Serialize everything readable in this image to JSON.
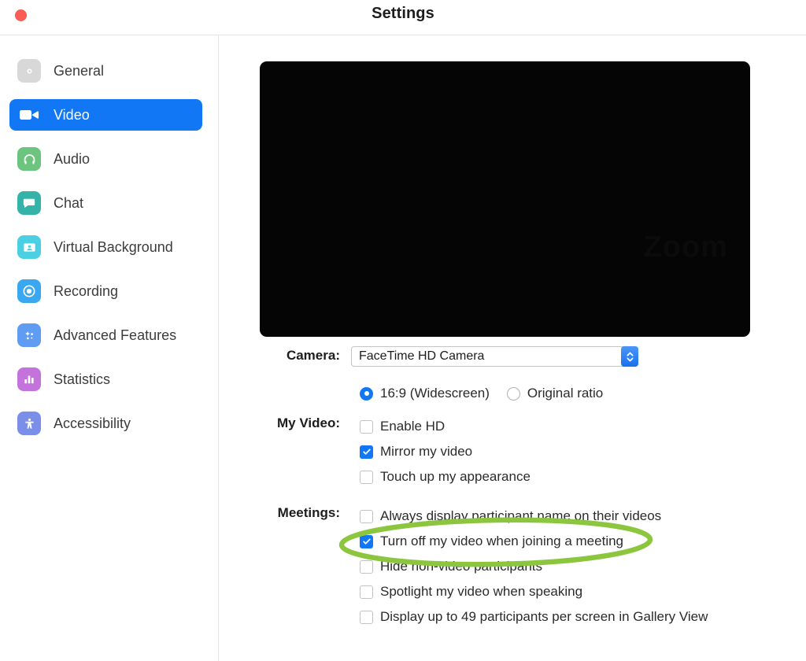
{
  "window": {
    "title": "Settings",
    "close_icon": "close-traffic-light",
    "close_color": "#fc5d55"
  },
  "sidebar": {
    "items": [
      {
        "label": "General",
        "icon": "gear-icon",
        "icon_color": "#d8d8d8",
        "selected": false
      },
      {
        "label": "Video",
        "icon": "camcorder-icon",
        "icon_color": "#1277f5",
        "selected": true
      },
      {
        "label": "Audio",
        "icon": "headphones-icon",
        "icon_color": "#6cc47f",
        "selected": false
      },
      {
        "label": "Chat",
        "icon": "speech-bubble-icon",
        "icon_color": "#36b3a8",
        "selected": false
      },
      {
        "label": "Virtual Background",
        "icon": "person-card-icon",
        "icon_color": "#4bcfe2",
        "selected": false
      },
      {
        "label": "Recording",
        "icon": "record-circle-icon",
        "icon_color": "#3aa8f0",
        "selected": false
      },
      {
        "label": "Advanced Features",
        "icon": "sparkle-icon",
        "icon_color": "#5f9cf2",
        "selected": false
      },
      {
        "label": "Statistics",
        "icon": "bar-chart-icon",
        "icon_color": "#c473dd",
        "selected": false
      },
      {
        "label": "Accessibility",
        "icon": "accessibility-icon",
        "icon_color": "#7b8ee8",
        "selected": false
      }
    ]
  },
  "main": {
    "video_preview": {
      "name": "video-preview",
      "background_color": "#050505",
      "ghost_text": "Zoom"
    },
    "camera": {
      "label": "Camera:",
      "selected_device": "FaceTime HD Camera",
      "options": [
        "FaceTime HD Camera"
      ],
      "stepper_color": "#1a72ef"
    },
    "aspect_ratio": {
      "options": [
        {
          "label": "16:9 (Widescreen)",
          "selected": true
        },
        {
          "label": "Original ratio",
          "selected": false
        }
      ],
      "accent_color": "#1277f5"
    },
    "my_video": {
      "label": "My Video:",
      "options": [
        {
          "label": "Enable HD",
          "checked": false
        },
        {
          "label": "Mirror my video",
          "checked": true
        },
        {
          "label": "Touch up my appearance",
          "checked": false
        }
      ]
    },
    "meetings": {
      "label": "Meetings:",
      "options": [
        {
          "label": "Always display participant name on their videos",
          "checked": false
        },
        {
          "label": "Turn off my video when joining a meeting",
          "checked": true
        },
        {
          "label": "Hide non-video participants",
          "checked": false
        },
        {
          "label": "Spotlight my video when speaking",
          "checked": false
        },
        {
          "label": "Display up to 49 participants per screen in Gallery View",
          "checked": false
        }
      ]
    }
  },
  "annotation": {
    "shape": "ellipse-highlight",
    "color": "#8cc63f",
    "stroke_width": 6,
    "targets_option": "Turn off my video when joining a meeting"
  }
}
